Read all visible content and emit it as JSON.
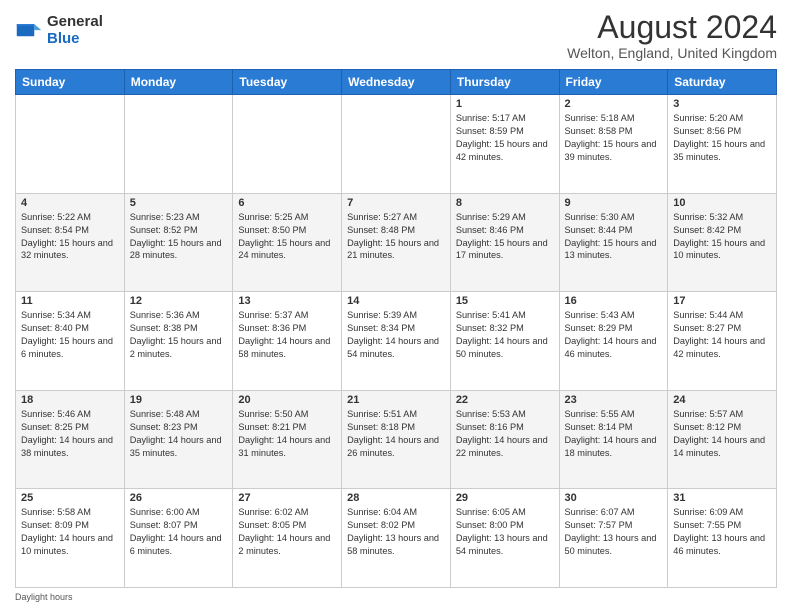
{
  "logo": {
    "general": "General",
    "blue": "Blue"
  },
  "title": "August 2024",
  "subtitle": "Welton, England, United Kingdom",
  "days_of_week": [
    "Sunday",
    "Monday",
    "Tuesday",
    "Wednesday",
    "Thursday",
    "Friday",
    "Saturday"
  ],
  "footer": "Daylight hours",
  "weeks": [
    [
      {
        "day": "",
        "info": ""
      },
      {
        "day": "",
        "info": ""
      },
      {
        "day": "",
        "info": ""
      },
      {
        "day": "",
        "info": ""
      },
      {
        "day": "1",
        "info": "Sunrise: 5:17 AM\nSunset: 8:59 PM\nDaylight: 15 hours and 42 minutes."
      },
      {
        "day": "2",
        "info": "Sunrise: 5:18 AM\nSunset: 8:58 PM\nDaylight: 15 hours and 39 minutes."
      },
      {
        "day": "3",
        "info": "Sunrise: 5:20 AM\nSunset: 8:56 PM\nDaylight: 15 hours and 35 minutes."
      }
    ],
    [
      {
        "day": "4",
        "info": "Sunrise: 5:22 AM\nSunset: 8:54 PM\nDaylight: 15 hours and 32 minutes."
      },
      {
        "day": "5",
        "info": "Sunrise: 5:23 AM\nSunset: 8:52 PM\nDaylight: 15 hours and 28 minutes."
      },
      {
        "day": "6",
        "info": "Sunrise: 5:25 AM\nSunset: 8:50 PM\nDaylight: 15 hours and 24 minutes."
      },
      {
        "day": "7",
        "info": "Sunrise: 5:27 AM\nSunset: 8:48 PM\nDaylight: 15 hours and 21 minutes."
      },
      {
        "day": "8",
        "info": "Sunrise: 5:29 AM\nSunset: 8:46 PM\nDaylight: 15 hours and 17 minutes."
      },
      {
        "day": "9",
        "info": "Sunrise: 5:30 AM\nSunset: 8:44 PM\nDaylight: 15 hours and 13 minutes."
      },
      {
        "day": "10",
        "info": "Sunrise: 5:32 AM\nSunset: 8:42 PM\nDaylight: 15 hours and 10 minutes."
      }
    ],
    [
      {
        "day": "11",
        "info": "Sunrise: 5:34 AM\nSunset: 8:40 PM\nDaylight: 15 hours and 6 minutes."
      },
      {
        "day": "12",
        "info": "Sunrise: 5:36 AM\nSunset: 8:38 PM\nDaylight: 15 hours and 2 minutes."
      },
      {
        "day": "13",
        "info": "Sunrise: 5:37 AM\nSunset: 8:36 PM\nDaylight: 14 hours and 58 minutes."
      },
      {
        "day": "14",
        "info": "Sunrise: 5:39 AM\nSunset: 8:34 PM\nDaylight: 14 hours and 54 minutes."
      },
      {
        "day": "15",
        "info": "Sunrise: 5:41 AM\nSunset: 8:32 PM\nDaylight: 14 hours and 50 minutes."
      },
      {
        "day": "16",
        "info": "Sunrise: 5:43 AM\nSunset: 8:29 PM\nDaylight: 14 hours and 46 minutes."
      },
      {
        "day": "17",
        "info": "Sunrise: 5:44 AM\nSunset: 8:27 PM\nDaylight: 14 hours and 42 minutes."
      }
    ],
    [
      {
        "day": "18",
        "info": "Sunrise: 5:46 AM\nSunset: 8:25 PM\nDaylight: 14 hours and 38 minutes."
      },
      {
        "day": "19",
        "info": "Sunrise: 5:48 AM\nSunset: 8:23 PM\nDaylight: 14 hours and 35 minutes."
      },
      {
        "day": "20",
        "info": "Sunrise: 5:50 AM\nSunset: 8:21 PM\nDaylight: 14 hours and 31 minutes."
      },
      {
        "day": "21",
        "info": "Sunrise: 5:51 AM\nSunset: 8:18 PM\nDaylight: 14 hours and 26 minutes."
      },
      {
        "day": "22",
        "info": "Sunrise: 5:53 AM\nSunset: 8:16 PM\nDaylight: 14 hours and 22 minutes."
      },
      {
        "day": "23",
        "info": "Sunrise: 5:55 AM\nSunset: 8:14 PM\nDaylight: 14 hours and 18 minutes."
      },
      {
        "day": "24",
        "info": "Sunrise: 5:57 AM\nSunset: 8:12 PM\nDaylight: 14 hours and 14 minutes."
      }
    ],
    [
      {
        "day": "25",
        "info": "Sunrise: 5:58 AM\nSunset: 8:09 PM\nDaylight: 14 hours and 10 minutes."
      },
      {
        "day": "26",
        "info": "Sunrise: 6:00 AM\nSunset: 8:07 PM\nDaylight: 14 hours and 6 minutes."
      },
      {
        "day": "27",
        "info": "Sunrise: 6:02 AM\nSunset: 8:05 PM\nDaylight: 14 hours and 2 minutes."
      },
      {
        "day": "28",
        "info": "Sunrise: 6:04 AM\nSunset: 8:02 PM\nDaylight: 13 hours and 58 minutes."
      },
      {
        "day": "29",
        "info": "Sunrise: 6:05 AM\nSunset: 8:00 PM\nDaylight: 13 hours and 54 minutes."
      },
      {
        "day": "30",
        "info": "Sunrise: 6:07 AM\nSunset: 7:57 PM\nDaylight: 13 hours and 50 minutes."
      },
      {
        "day": "31",
        "info": "Sunrise: 6:09 AM\nSunset: 7:55 PM\nDaylight: 13 hours and 46 minutes."
      }
    ]
  ]
}
